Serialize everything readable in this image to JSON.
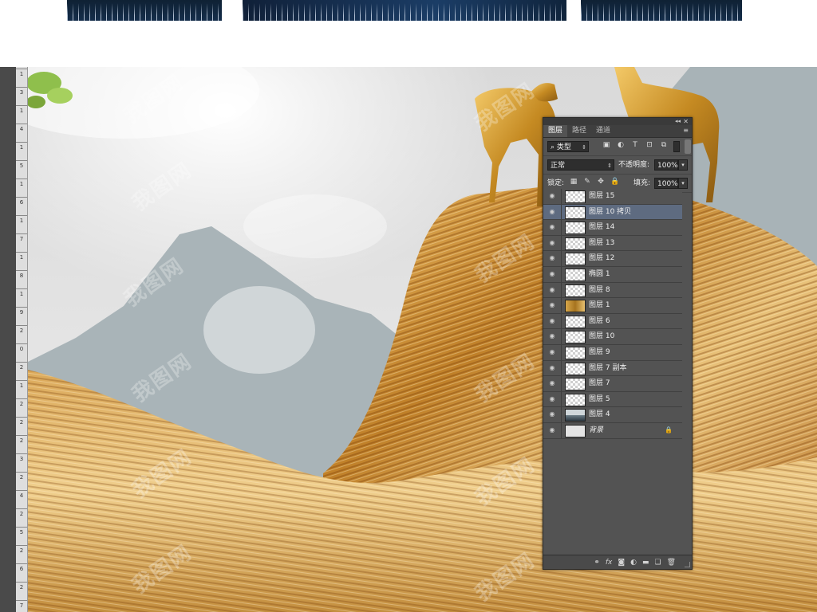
{
  "panel": {
    "tabs": [
      "图层",
      "路径",
      "通道"
    ],
    "filter": {
      "kind_label": "类型"
    },
    "blend_mode": "正常",
    "opacity_label": "不透明度:",
    "opacity_value": "100%",
    "lock_label": "锁定:",
    "fill_label": "填充:",
    "fill_value": "100%",
    "layers": [
      {
        "name": "图层 15",
        "thumb": "transparent",
        "selected": false
      },
      {
        "name": "图层 10 拷贝",
        "thumb": "transparent",
        "selected": true
      },
      {
        "name": "图层 14",
        "thumb": "transparent",
        "selected": false
      },
      {
        "name": "图层 13",
        "thumb": "transparent",
        "selected": false
      },
      {
        "name": "图层 12",
        "thumb": "transparent",
        "selected": false
      },
      {
        "name": "椭圆 1",
        "thumb": "transparent",
        "selected": false
      },
      {
        "name": "图层 8",
        "thumb": "transparent",
        "selected": false
      },
      {
        "name": "图层 1",
        "thumb": "gold",
        "selected": false
      },
      {
        "name": "图层 6",
        "thumb": "transparent",
        "selected": false
      },
      {
        "name": "图层 10",
        "thumb": "transparent",
        "selected": false
      },
      {
        "name": "图层 9",
        "thumb": "transparent",
        "selected": false
      },
      {
        "name": "图层 7 副本",
        "thumb": "transparent",
        "selected": false
      },
      {
        "name": "图层 7",
        "thumb": "transparent",
        "selected": false
      },
      {
        "name": "图层 5",
        "thumb": "transparent",
        "selected": false
      },
      {
        "name": "图层 4",
        "thumb": "mount",
        "selected": false
      },
      {
        "name": "背景",
        "thumb": "bg",
        "selected": false,
        "locked": true
      }
    ]
  },
  "ruler_ticks": [
    "1",
    "3",
    "1",
    "4",
    "1",
    "5",
    "1",
    "6",
    "1",
    "7",
    "1",
    "8",
    "1",
    "9",
    "2",
    "0",
    "2",
    "1",
    "2",
    "2",
    "2",
    "3",
    "2",
    "4",
    "2",
    "5",
    "2",
    "6",
    "2",
    "7"
  ],
  "watermark_text": "我图网",
  "colors": {
    "panel_bg": "#535353",
    "selected_row": "#5e6b80",
    "gold": "#c9922e",
    "mountain": "#a9b4b8"
  }
}
